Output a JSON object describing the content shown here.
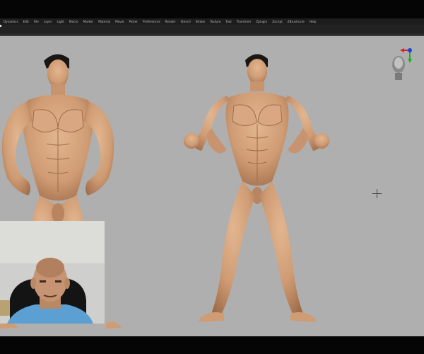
{
  "menu": {
    "items": [
      "Dynamics",
      "Edit",
      "File",
      "Layer",
      "Light",
      "Macro",
      "Marker",
      "Material",
      "Movie",
      "Picker",
      "Preferences",
      "Render",
      "Stencil",
      "Stroke",
      "Texture",
      "Tool",
      "Transform",
      "Zplugin",
      "Zscript",
      "ZBrushcore",
      "Help"
    ]
  },
  "viewport": {
    "background": "#afafaf",
    "skin_color": "#d0a27a",
    "shade_color": "#9c6a48"
  },
  "icons": {
    "gizmo": "navigation-gizmo-icon",
    "cursor": "crosshair-icon"
  }
}
